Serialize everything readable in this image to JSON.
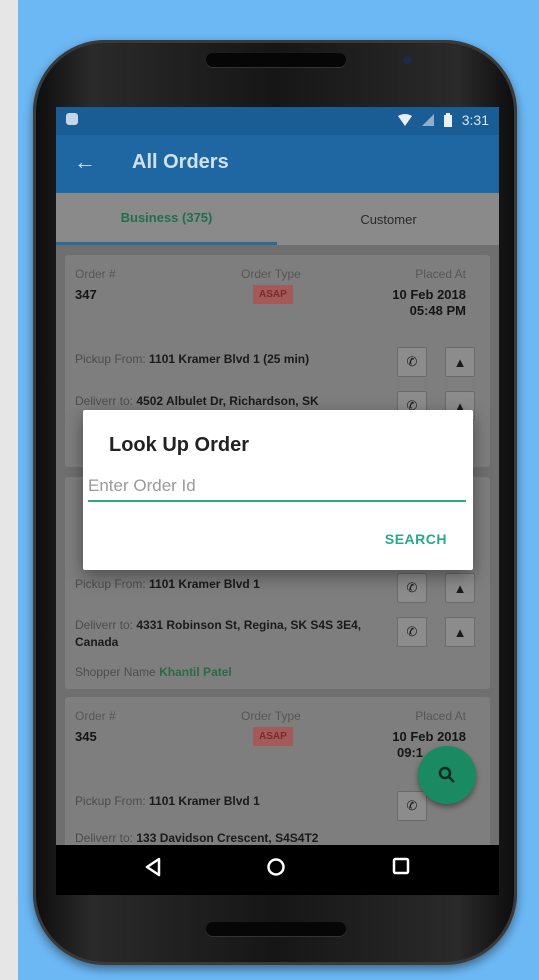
{
  "status_bar": {
    "time": "3:31"
  },
  "app_bar": {
    "title": "All Orders"
  },
  "tabs": [
    {
      "label": "Business (375)",
      "active": true
    },
    {
      "label": "Customer",
      "active": false
    }
  ],
  "orders": [
    {
      "order_label": "Order #",
      "order_number": "347",
      "type_label": "Order Type",
      "type": "ASAP",
      "placed_label": "Placed At",
      "placed_date": "10 Feb 2018",
      "placed_time": "05:48 PM",
      "pickup_label": "Pickup From:",
      "pickup": "1101 Kramer Blvd 1 (25 min)",
      "deliver_label": "Deliverr to:",
      "deliver": "4502 Albulet Dr, Richardson, SK"
    },
    {
      "pickup_label": "Pickup From:",
      "pickup": "1101 Kramer Blvd 1",
      "deliver_label": "Deliverr to:",
      "deliver": "4331 Robinson St, Regina, SK S4S 3E4, Canada",
      "shopper_label": "Shopper Name",
      "shopper": "Khantil Patel"
    },
    {
      "order_label": "Order #",
      "order_number": "345",
      "type_label": "Order Type",
      "type": "ASAP",
      "placed_label": "Placed At",
      "placed_date": "10 Feb 2018",
      "placed_time": "09:1",
      "pickup_label": "Pickup From:",
      "pickup": "1101 Kramer Blvd 1",
      "deliver_label": "Deliverr to:",
      "deliver": "133 Davidson Crescent, S4S4T2"
    }
  ],
  "dialog": {
    "title": "Look Up Order",
    "input_placeholder": "Enter Order Id",
    "search_label": "SEARCH"
  },
  "colors": {
    "app_bar": "#1f67a2",
    "accent": "#28a98a",
    "fab": "#1a8a62",
    "background": "#6cb8f5"
  },
  "icons": [
    "back-arrow-icon",
    "wifi-icon",
    "signal-icon",
    "battery-icon",
    "phone-icon",
    "navigation-icon",
    "search-icon",
    "back-nav-icon",
    "home-nav-icon",
    "recents-nav-icon"
  ]
}
